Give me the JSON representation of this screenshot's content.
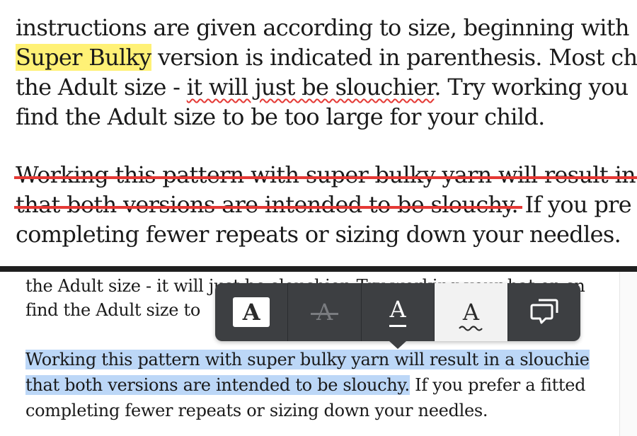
{
  "top_excerpt": {
    "line1": "instructions are given according to size, beginning with ",
    "line2_highlight": "Super Bulky",
    "line2_rest": " version is indicated in parenthesis.  Most ch",
    "line3_pre": "the Adult size - ",
    "line3_squiggle": "it will just be slouchier",
    "line3_post": ". Try working you",
    "line4": "find the Adult size to be too large for your child.",
    "line5_strike": "Working this pattern with super bulky yarn will result in",
    "line6_strike": "that both versions are intended to be slouchy.",
    "line6_post": " If you pre",
    "line7": "completing fewer repeats or sizing down your needles."
  },
  "bottom_excerpt": {
    "line1": "the Adult size - it will just be slouchier. Try working your hat on sn",
    "line2": "find the Adult size to",
    "line3_selected": "Working this pattern with super bulky yarn will result in a slouchie",
    "line4_selected": "that both versions are intended to be slouchy.",
    "line4_post": "  If you prefer a fitted",
    "line5": "completing fewer repeats or sizing down your needles."
  },
  "toolbar": {
    "highlight_glyph": "A",
    "strikethrough_glyph": "A",
    "underline_glyph": "A",
    "squiggle_glyph": "A",
    "comment_icon": "comment-icon",
    "active_tool": "squiggle"
  },
  "colors": {
    "highlight_yellow": "#fff176",
    "markup_red": "#e53935",
    "selection_blue": "#bcd7f7",
    "toolbar_bg": "#3d3f42"
  }
}
